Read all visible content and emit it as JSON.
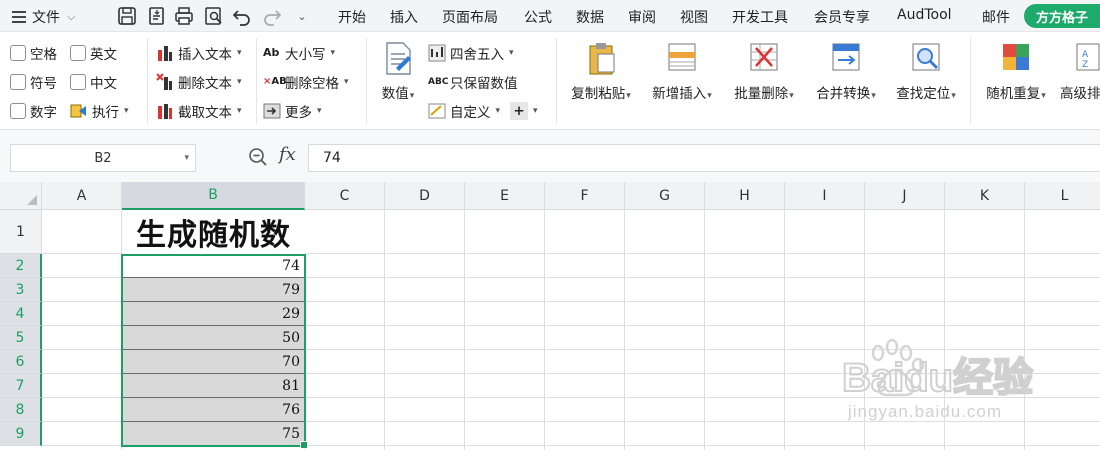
{
  "menubar": {
    "file_label": "文件",
    "tabs": [
      "开始",
      "插入",
      "页面布局",
      "公式",
      "数据",
      "审阅",
      "视图",
      "开发工具",
      "会员专享",
      "AudTool",
      "邮件"
    ],
    "badge": "方方格子"
  },
  "ribbon": {
    "checkboxes": [
      "空格",
      "英文",
      "符号",
      "中文",
      "数字"
    ],
    "execute": "执行",
    "text_tools": [
      "插入文本",
      "删除文本",
      "截取文本"
    ],
    "case_tools": [
      "大小写",
      "删除空格",
      "更多"
    ],
    "value_btn": "数值",
    "num_tools": [
      "四舍五入",
      "只保留数值",
      "自定义"
    ],
    "big_buttons": [
      "复制粘贴",
      "新增插入",
      "批量删除",
      "合并转换",
      "查找定位",
      "随机重复",
      "高级排"
    ]
  },
  "formula": {
    "cell_ref": "B2",
    "fx": "fx",
    "value": "74"
  },
  "sheet": {
    "columns": [
      "A",
      "B",
      "C",
      "D",
      "E",
      "F",
      "G",
      "H",
      "I",
      "J",
      "K",
      "L"
    ],
    "rows": [
      "1",
      "2",
      "3",
      "4",
      "5",
      "6",
      "7",
      "8",
      "9"
    ],
    "header": "生成随机数",
    "values": [
      "74",
      "79",
      "29",
      "50",
      "70",
      "81",
      "76",
      "75"
    ]
  },
  "watermark": {
    "brand": "Baidu经验",
    "url": "jingyan.baidu.com"
  },
  "colors": {
    "accent": "#1e9e62",
    "badge": "#1eaa6b",
    "selection_fill": "#d9d9d9"
  }
}
